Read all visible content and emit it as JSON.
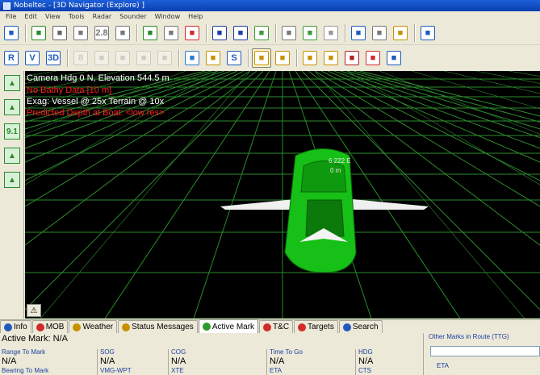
{
  "window": {
    "title": "Nobeltec - [3D Navigator (Explore)   ]"
  },
  "menu": [
    "File",
    "Edit",
    "View",
    "Tools",
    "Radar",
    "Sounder",
    "Window",
    "Help"
  ],
  "toolbar1": [
    {
      "icon": "chart-icon",
      "color": "#1f5bbf"
    },
    {
      "icon": "route-icon",
      "color": "#2a8a2a"
    },
    {
      "icon": "wrench-icon",
      "color": "#666666"
    },
    {
      "icon": "measure-icon",
      "color": "#777777"
    },
    {
      "icon": "zoom-level-icon",
      "color": "#777777",
      "text": "2.8"
    },
    {
      "icon": "select-icon",
      "color": "#777777"
    },
    {
      "icon": "boat-center-icon",
      "color": "#2a8a2a"
    },
    {
      "icon": "pan-icon",
      "color": "#777777"
    },
    {
      "icon": "lifebuoy-icon",
      "color": "#d22a2a"
    },
    {
      "icon": "zoom-out-icon",
      "color": "#1a3ea0"
    },
    {
      "icon": "zoom-in-icon",
      "color": "#1a3ea0"
    },
    {
      "icon": "pencil-icon",
      "color": "#3c9a3c"
    },
    {
      "icon": "north-up-icon",
      "color": "#777777"
    },
    {
      "icon": "pen-icon",
      "color": "#3c9a3c"
    },
    {
      "icon": "no-entry-icon",
      "color": "#999999"
    },
    {
      "icon": "split-view-icon",
      "color": "#1f5bbf"
    },
    {
      "icon": "layers-icon",
      "color": "#777777"
    },
    {
      "icon": "settings-icon",
      "color": "#c89000"
    },
    {
      "icon": "notes-icon",
      "color": "#1f5bbf"
    }
  ],
  "toolbar2": [
    {
      "icon": "raster-chart-icon",
      "color": "#1f5bbf",
      "text": "R"
    },
    {
      "icon": "vector-chart-icon",
      "color": "#1f5bbf",
      "text": "V"
    },
    {
      "icon": "3d-view-icon",
      "color": "#1f5bbf",
      "text": "3D"
    },
    {
      "icon": "layer-8-icon",
      "color": "#999999",
      "text": "8",
      "disabled": true
    },
    {
      "icon": "layer-icon",
      "color": "#999999",
      "disabled": true
    },
    {
      "icon": "document-icon",
      "color": "#999999",
      "disabled": true
    },
    {
      "icon": "document-2-icon",
      "color": "#999999",
      "disabled": true
    },
    {
      "icon": "info-icon",
      "color": "#999999",
      "disabled": true
    },
    {
      "icon": "globe-icon",
      "color": "#2a7ad2"
    },
    {
      "icon": "tide-icon",
      "color": "#c89000"
    },
    {
      "icon": "current-icon",
      "color": "#1f5bbf",
      "text": "S"
    },
    {
      "icon": "alarm-icon",
      "color": "#c89000",
      "active": true
    },
    {
      "icon": "books-icon",
      "color": "#c89000"
    },
    {
      "icon": "night-mode-icon",
      "color": "#c89000"
    },
    {
      "icon": "dusk-mode-icon",
      "color": "#c89000"
    },
    {
      "icon": "red-night-icon",
      "color": "#b02020"
    },
    {
      "icon": "record-icon",
      "color": "#d22a2a"
    },
    {
      "icon": "sensors-icon",
      "color": "#1f5bbf"
    }
  ],
  "lefttools": [
    {
      "icon": "tilt-view-icon",
      "color": "#2a8a2a"
    },
    {
      "icon": "heading-icon",
      "color": "#2a8a2a"
    },
    {
      "icon": "speed-icon",
      "color": "#2a8a2a",
      "text": "9.1"
    },
    {
      "icon": "vessel-forward-icon",
      "color": "#2a8a2a"
    },
    {
      "icon": "add-vessel-icon",
      "color": "#2a8a2a"
    }
  ],
  "viewport": {
    "camera": "Camera Hdg 0 N, Elevation 544.5 m",
    "bathy": "No Bathy Data [10 m]",
    "exag": "Exag: Vessel @ 25x Terrain @ 10x",
    "depth": "Predicted Depth at Boat: <low res>",
    "boat_label_1": "6.222 E",
    "boat_label_2": "0 m",
    "colors": {
      "grid": "#2e8a2e",
      "hull": "#16c016",
      "background": "#000000"
    }
  },
  "tabs": [
    {
      "label": "Info",
      "icon": "info-tab-icon",
      "color": "#1f5bbf"
    },
    {
      "label": "MOB",
      "icon": "mob-tab-icon",
      "color": "#d22a2a"
    },
    {
      "label": "Weather",
      "icon": "weather-tab-icon",
      "color": "#c89000"
    },
    {
      "label": "Status Messages",
      "icon": "warning-tab-icon",
      "color": "#c89000"
    },
    {
      "label": "Active Mark",
      "icon": "active-mark-tab-icon",
      "color": "#2a9a2a",
      "selected": true
    },
    {
      "label": "T&C",
      "icon": "tc-tab-icon",
      "color": "#d22a2a"
    },
    {
      "label": "Targets",
      "icon": "targets-tab-icon",
      "color": "#d22a2a"
    },
    {
      "label": "Search",
      "icon": "search-tab-icon",
      "color": "#1f5bbf"
    }
  ],
  "panel": {
    "active_mark": "Active Mark: N/A",
    "columns": [
      {
        "header": "Range To Mark",
        "value": "N/A",
        "sub": "Bearing To Mark"
      },
      {
        "header": "SOG",
        "value": "N/A",
        "sub": "VMG-WPT"
      },
      {
        "header": "COG",
        "value": "N/A",
        "sub": "XTE"
      },
      {
        "header": "Time To Go",
        "value": "N/A",
        "sub": "ETA"
      },
      {
        "header": "HDG",
        "value": "N/A",
        "sub": "CTS"
      }
    ],
    "other_marks_title": "Other Marks in Route (TTG)",
    "eta_label": "ETA"
  }
}
